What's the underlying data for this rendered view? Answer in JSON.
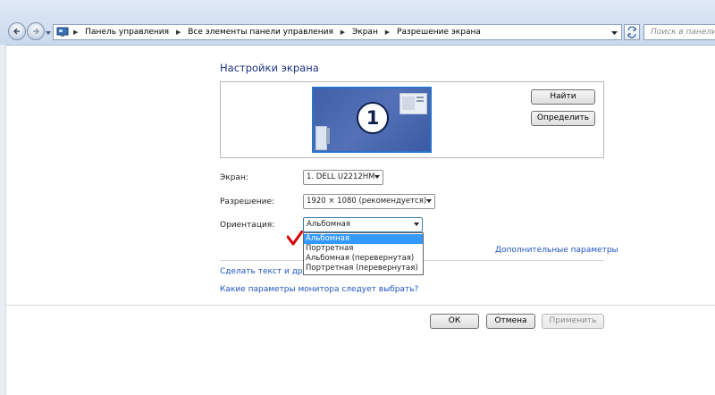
{
  "address_bar": {
    "breadcrumbs": [
      "Панель управления",
      "Все элементы панели управления",
      "Экран",
      "Разрешение экрана"
    ]
  },
  "search": {
    "placeholder": "Поиск в панели уп"
  },
  "page": {
    "title": "Настройки экрана"
  },
  "preview": {
    "monitor_number": "1"
  },
  "buttons": {
    "find": "Найти",
    "identify": "Определить",
    "ok": "ОК",
    "cancel": "Отмена",
    "apply": "Применить"
  },
  "settings": {
    "screen_label": "Экран:",
    "screen_value": "1. DELL U2212HM",
    "resolution_label": "Разрешение:",
    "resolution_value": "1920 × 1080 (рекомендуется)",
    "orientation_label": "Ориентация:",
    "orientation_value": "Альбомная",
    "orientation_options": [
      "Альбомная",
      "Портретная",
      "Альбомная (перевернутая)",
      "Портретная (перевернутая)"
    ]
  },
  "links": {
    "advanced": "Дополнительные параметры",
    "text_size": "Сделать текст и другие",
    "which_settings": "Какие параметры монитора следует выбрать?"
  },
  "colors": {
    "accent": "#3399ff",
    "link": "#1f54c2",
    "title": "#1e3287",
    "check": "#d80000"
  }
}
